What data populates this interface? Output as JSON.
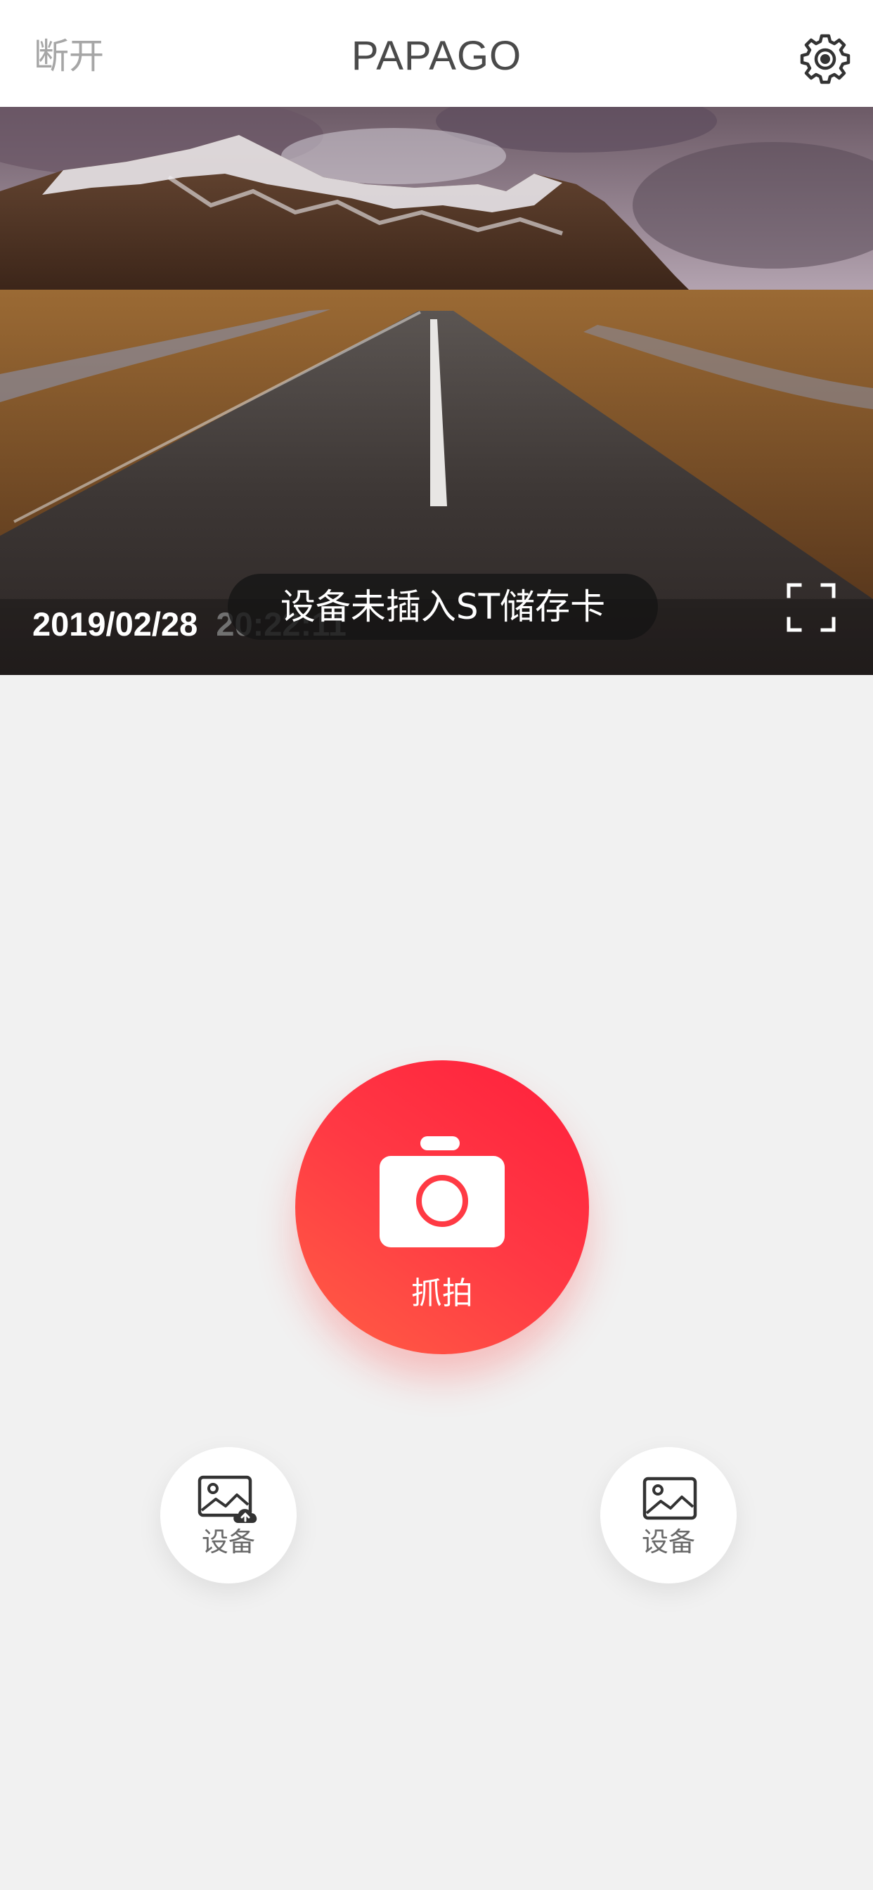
{
  "header": {
    "disconnect_label": "断开",
    "title": "PAPAGO",
    "settings_icon": "gear-icon"
  },
  "preview": {
    "date": "2019/02/28",
    "time": "20:22:11",
    "toast": "设备未插入ST储存卡",
    "fullscreen_icon": "fullscreen-icon"
  },
  "capture": {
    "label": "抓拍",
    "icon": "camera-icon",
    "gradient_start": "#ff5f44",
    "gradient_end": "#ff1f3c"
  },
  "bottom_buttons": [
    {
      "label": "设备",
      "icon": "image-cloud-icon"
    },
    {
      "label": "设备",
      "icon": "image-icon"
    }
  ],
  "colors": {
    "background": "#f1f1f1",
    "header": "#ffffff",
    "accent": "#ff3944"
  }
}
